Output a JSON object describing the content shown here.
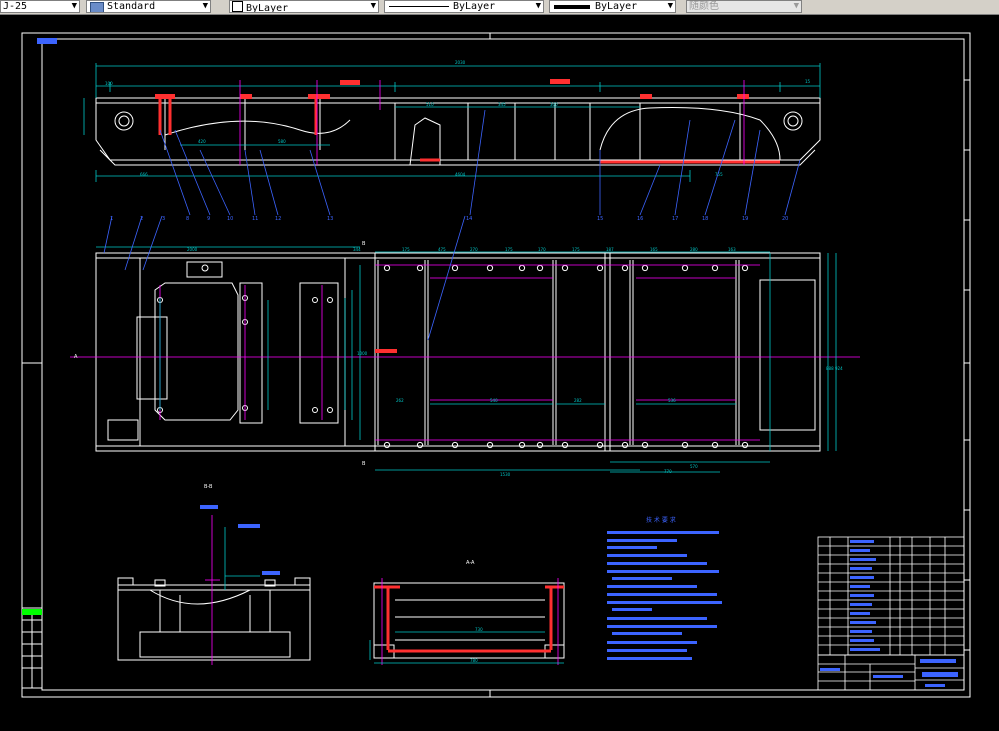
{
  "toolbar": {
    "dimstyle": "J-25",
    "textstyle": "Standard",
    "layer": "ByLayer",
    "linetype": "ByLayer",
    "lineweight": "ByLayer",
    "plotstyle": "随颜色"
  },
  "colors": {
    "background": "#000000",
    "frame": "#ffffff",
    "dimension": "#00c8c8",
    "centerline": "#ff00ff",
    "weld": "#ff3030",
    "note": "#3c64ff",
    "leader": "#3c64ff",
    "toolbar": "#d4d0c8"
  },
  "drawing": {
    "section_b_label": "B-B",
    "section_a_label": "A-A",
    "dim_overall_left": "1000",
    "dim_plan_width": "1000",
    "dim_section_width": "780"
  },
  "notes_title": "技 术 要 求"
}
